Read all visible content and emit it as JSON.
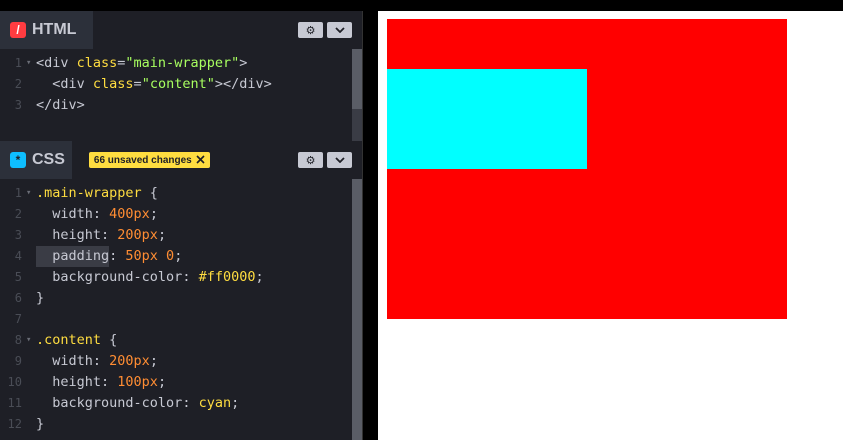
{
  "html_panel": {
    "label": "HTML",
    "icon": "/",
    "lines": [
      {
        "n": "1",
        "fold": "▾",
        "parts": [
          [
            "t-tag",
            "<div "
          ],
          [
            "t-attr",
            "class"
          ],
          [
            "t-tag",
            "="
          ],
          [
            "t-str",
            "\"main-wrapper\""
          ],
          [
            "t-tag",
            ">"
          ]
        ]
      },
      {
        "n": "2",
        "fold": "",
        "parts": [
          [
            "t-tag",
            "  <div "
          ],
          [
            "t-attr",
            "class"
          ],
          [
            "t-tag",
            "="
          ],
          [
            "t-str",
            "\"content\""
          ],
          [
            "t-tag",
            "></div>"
          ]
        ]
      },
      {
        "n": "3",
        "fold": "",
        "parts": [
          [
            "t-tag",
            "</div>"
          ]
        ]
      }
    ]
  },
  "css_panel": {
    "label": "CSS",
    "icon": "*",
    "badge": "66 unsaved changes",
    "lines": [
      {
        "n": "1",
        "fold": "▾",
        "parts": [
          [
            "t-sel",
            ".main-wrapper"
          ],
          [
            "txt",
            " {"
          ]
        ]
      },
      {
        "n": "2",
        "fold": "",
        "parts": [
          [
            "t-prop",
            "  width"
          ],
          [
            "txt",
            ": "
          ],
          [
            "t-num",
            "400px"
          ],
          [
            "txt",
            ";"
          ]
        ]
      },
      {
        "n": "3",
        "fold": "",
        "parts": [
          [
            "t-prop",
            "  height"
          ],
          [
            "txt",
            ": "
          ],
          [
            "t-num",
            "200px"
          ],
          [
            "txt",
            ";"
          ]
        ]
      },
      {
        "n": "4",
        "fold": "",
        "parts": [
          [
            "t-prop t-hl",
            "  padding"
          ],
          [
            "txt",
            ": "
          ],
          [
            "t-num",
            "50px 0"
          ],
          [
            "txt",
            ";"
          ]
        ]
      },
      {
        "n": "5",
        "fold": "",
        "parts": [
          [
            "t-prop",
            "  background-color"
          ],
          [
            "txt",
            ": "
          ],
          [
            "t-val",
            "#ff0000"
          ],
          [
            "txt",
            ";"
          ]
        ]
      },
      {
        "n": "6",
        "fold": "",
        "parts": [
          [
            "txt",
            "}"
          ]
        ]
      },
      {
        "n": "7",
        "fold": "",
        "parts": [
          [
            "txt",
            ""
          ]
        ]
      },
      {
        "n": "8",
        "fold": "▾",
        "parts": [
          [
            "t-sel",
            ".content"
          ],
          [
            "txt",
            " {"
          ]
        ]
      },
      {
        "n": "9",
        "fold": "",
        "parts": [
          [
            "t-prop",
            "  width"
          ],
          [
            "txt",
            ": "
          ],
          [
            "t-num",
            "200px"
          ],
          [
            "txt",
            ";"
          ]
        ]
      },
      {
        "n": "10",
        "fold": "",
        "parts": [
          [
            "t-prop",
            "  height"
          ],
          [
            "txt",
            ": "
          ],
          [
            "t-num",
            "100px"
          ],
          [
            "txt",
            ";"
          ]
        ]
      },
      {
        "n": "11",
        "fold": "",
        "parts": [
          [
            "t-prop",
            "  background-color"
          ],
          [
            "txt",
            ": "
          ],
          [
            "t-val",
            "cyan"
          ],
          [
            "txt",
            ";"
          ]
        ]
      },
      {
        "n": "12",
        "fold": "",
        "parts": [
          [
            "txt",
            "}"
          ]
        ]
      }
    ]
  },
  "buttons": {
    "settings_icon": "⚙",
    "collapse_icon": "⌄"
  },
  "colors": {
    "wrapper_bg": "#ff0000",
    "content_bg": "cyan",
    "html_icon": "#ff3c41",
    "css_icon": "#0ebeff",
    "badge_bg": "#ffdd40"
  }
}
